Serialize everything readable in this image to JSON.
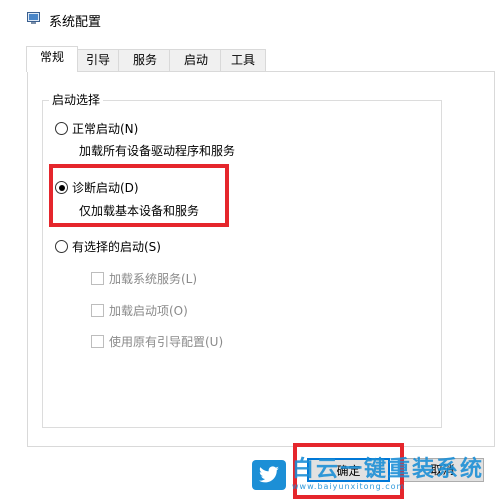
{
  "window": {
    "title": "系统配置"
  },
  "tabs": [
    {
      "label": "常规",
      "active": true
    },
    {
      "label": "引导",
      "active": false
    },
    {
      "label": "服务",
      "active": false
    },
    {
      "label": "启动",
      "active": false
    },
    {
      "label": "工具",
      "active": false
    }
  ],
  "startup_selection": {
    "legend": "启动选择",
    "normal": {
      "label": "正常启动(N)",
      "desc": "加载所有设备驱动程序和服务",
      "checked": false
    },
    "diagnostic": {
      "label": "诊断启动(D)",
      "desc": "仅加载基本设备和服务",
      "checked": true
    },
    "selective": {
      "label": "有选择的启动(S)",
      "checked": false,
      "options": [
        {
          "label": "加载系统服务(L)",
          "checked": false,
          "enabled": false
        },
        {
          "label": "加载启动项(O)",
          "checked": false,
          "enabled": false
        },
        {
          "label": "使用原有引导配置(U)",
          "checked": false,
          "enabled": false
        }
      ]
    }
  },
  "buttons": {
    "ok": "确定",
    "cancel": "取消"
  },
  "watermark": {
    "title": "白云一键重装系统",
    "url": "www.baiyunxitong.com"
  },
  "colors": {
    "highlight": "#e5262c",
    "accent": "#0078d7",
    "watermark": "#1c8fd6"
  }
}
